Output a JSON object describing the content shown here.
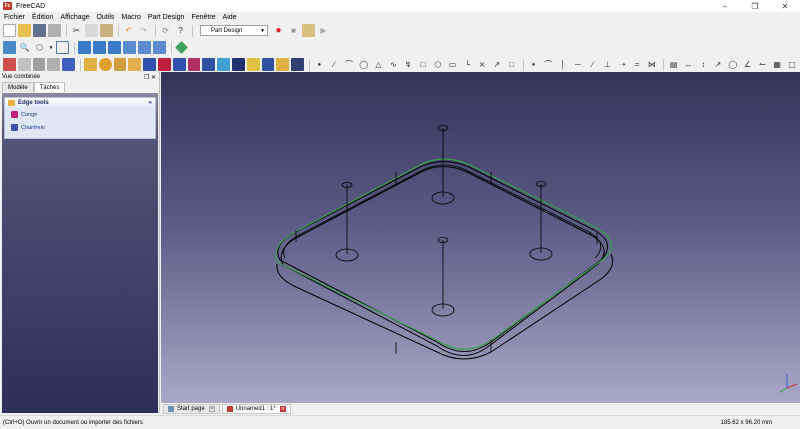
{
  "window": {
    "title": "FreeCAD",
    "logo_text": "Fc"
  },
  "menu": [
    "Fichier",
    "Édition",
    "Affichage",
    "Outils",
    "Macro",
    "Part Design",
    "Fenêtre",
    "Aide"
  ],
  "workbench": {
    "selected": "Part Design"
  },
  "combo_view": {
    "title": "Vue combinée",
    "tabs": [
      "Modèle",
      "Tâches"
    ],
    "taskbox": {
      "title": "Edge tools",
      "items": [
        "Congé",
        "Chanfrein"
      ]
    }
  },
  "doc_tabs": [
    "Start page",
    "Unnamed1 : 1*"
  ],
  "status": {
    "message": "(Ctrl+O) Ouvrir un document ou importer des fichiers",
    "dimensions": "185.62 x 96.20 mm"
  },
  "colors": {
    "viewport_top": "#33335a",
    "viewport_bottom": "#a8a8c8",
    "selected_edge": "#3aa04a",
    "edge": "#000000"
  }
}
